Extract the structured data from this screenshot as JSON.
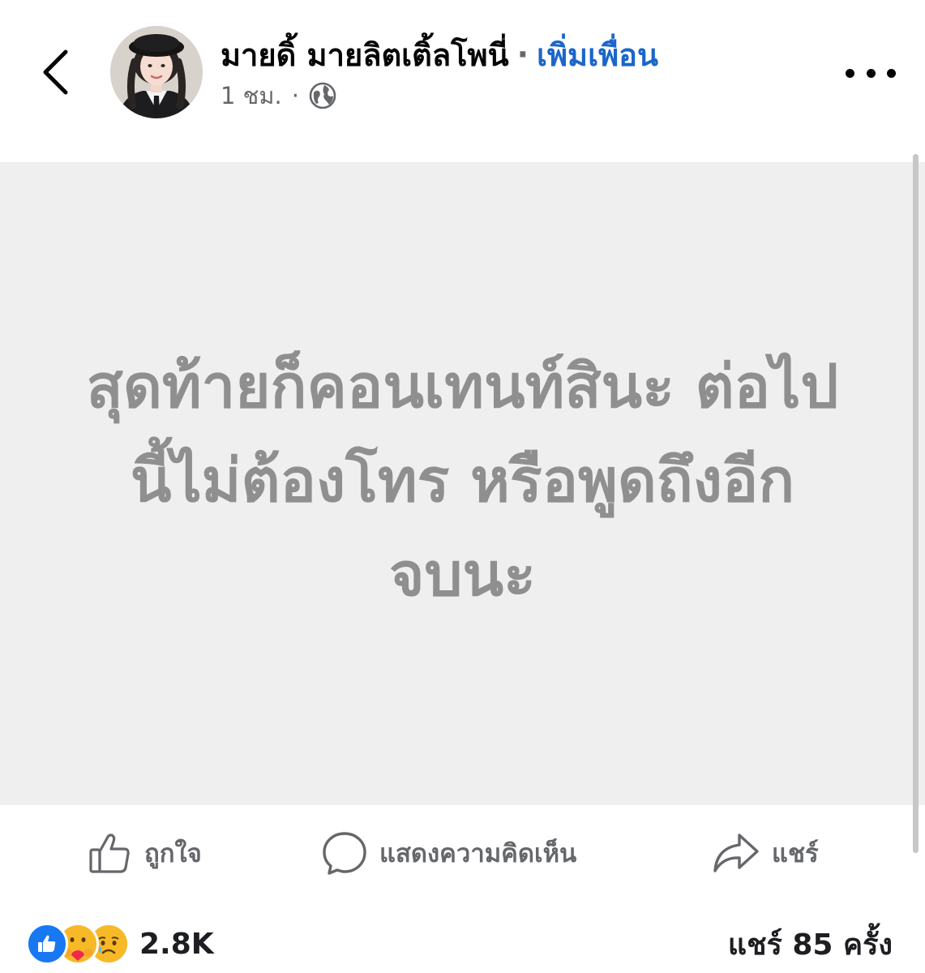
{
  "header": {
    "author_name": "มายดิ้ มายลิตเติ้ลโพนี่",
    "separator": "·",
    "add_friend_label": "เพิ่มเพื่อน",
    "timestamp": "1 ชม.",
    "meta_separator": "·",
    "audience_icon": "globe-icon",
    "back_icon": "chevron-left-icon",
    "more_icon": "more-horizontal-icon"
  },
  "post": {
    "text": "สุดท้ายก็คอนเทนท์สินะ ต่อไปนี้ไม่ต้องโทร หรือพูดถึงอีก จบนะ",
    "background_color": "#efefef",
    "text_color": "#8f8f8f"
  },
  "actions": {
    "like_label": "ถูกใจ",
    "like_icon": "thumbs-up-icon",
    "comment_label": "แสดงความคิดเห็น",
    "comment_icon": "comment-bubble-icon",
    "share_label": "แชร์",
    "share_icon": "share-arrow-icon"
  },
  "summary": {
    "reaction_icons": [
      "like-reaction-icon",
      "care-reaction-icon",
      "sad-reaction-icon"
    ],
    "reaction_count": "2.8K",
    "share_count": "แชร์ 85 ครั้ง"
  },
  "colors": {
    "link_blue": "#1b66c9",
    "secondary_text": "#65676b",
    "like_blue": "#1877f2",
    "reaction_yellow": "#f7b928"
  }
}
